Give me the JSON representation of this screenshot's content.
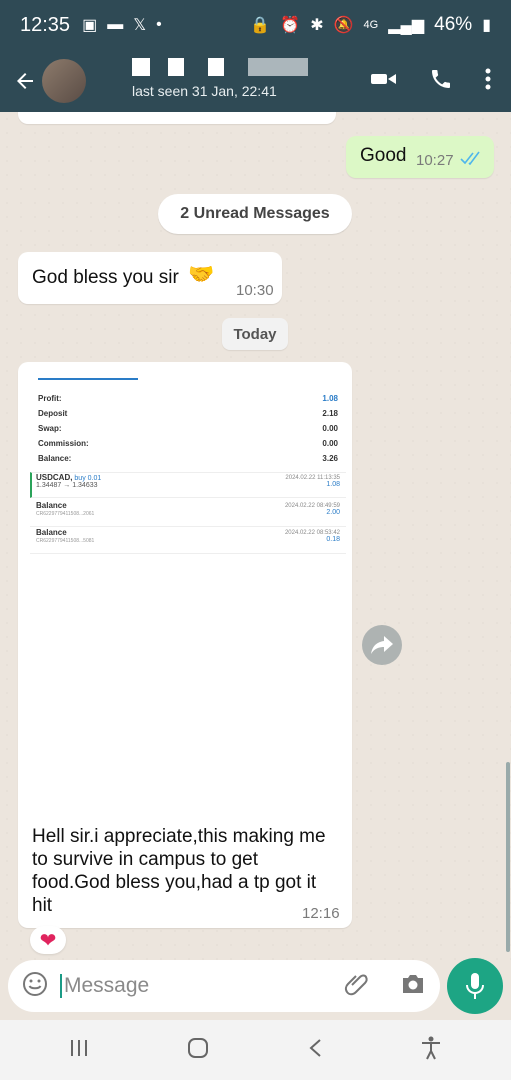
{
  "status_bar": {
    "time": "12:35",
    "battery": "46%",
    "network": "4G"
  },
  "app_bar": {
    "last_seen": "last seen 31 Jan, 22:41"
  },
  "messages": {
    "out_good": {
      "text": "Good",
      "time": "10:27"
    },
    "unread_banner": "2 Unread Messages",
    "in_bless": {
      "text": "God bless you sir",
      "emoji": "🤝",
      "time": "10:30"
    },
    "date_divider": "Today",
    "image_msg": {
      "caption": "Hell sir.i appreciate,this making me to survive in campus to get food.God bless you,had a tp got it hit",
      "time": "12:16",
      "reaction": "❤"
    }
  },
  "trade_summary": {
    "rows": [
      {
        "label": "Profit:",
        "value": "1.08"
      },
      {
        "label": "Deposit",
        "value": "2.18"
      },
      {
        "label": "Swap:",
        "value": "0.00"
      },
      {
        "label": "Commission:",
        "value": "0.00"
      },
      {
        "label": "Balance:",
        "value": "3.26"
      }
    ],
    "trades": [
      {
        "title": "USDCAD,",
        "side": "buy 0.01",
        "sub": "1.34487 → 1.34633",
        "date": "2024.02.22 11:13:35",
        "amount": "1.08"
      },
      {
        "title": "Balance",
        "side": "",
        "sub": "CR6229779411508...2061",
        "date": "2024.02.22 08:49:59",
        "amount": "2.00"
      },
      {
        "title": "Balance",
        "side": "",
        "sub": "CR6229779411508...5081",
        "date": "2024.02.22 08:53:42",
        "amount": "0.18"
      }
    ]
  },
  "input": {
    "placeholder": "Message"
  },
  "colors": {
    "header": "#2F4A55",
    "outgoing": "#DCF8C6",
    "accent": "#1DA584",
    "chat_bg": "#ECE5DD"
  }
}
